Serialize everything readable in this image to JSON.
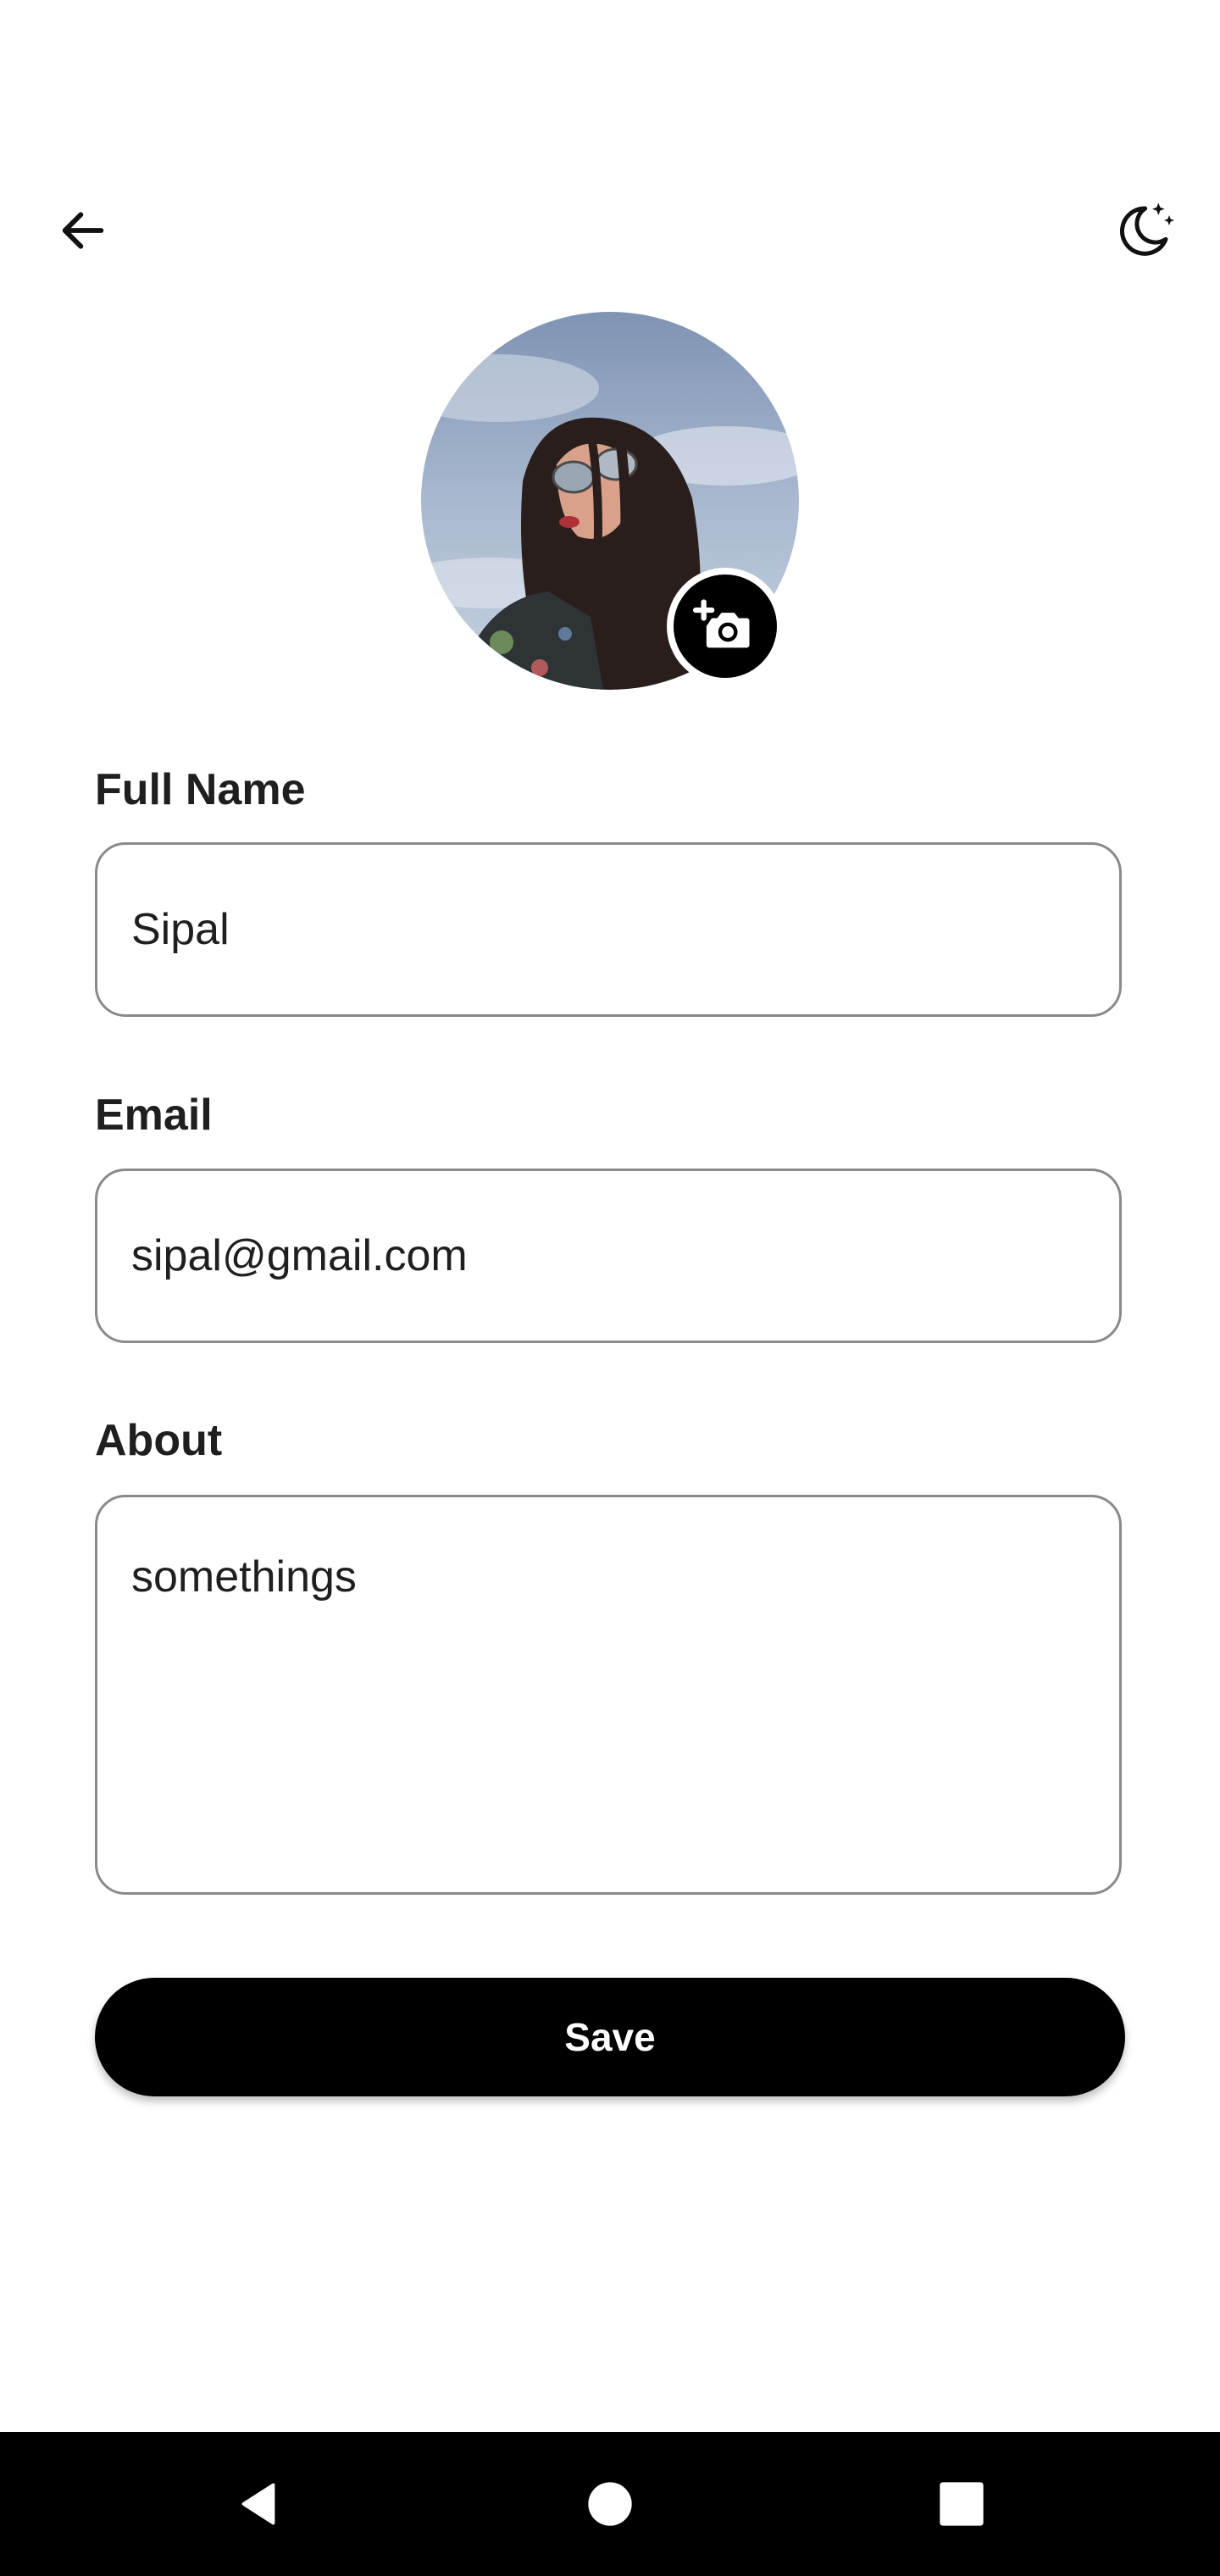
{
  "header": {
    "back_icon": "arrow-left-icon",
    "theme_icon": "moon-stars-icon"
  },
  "profile": {
    "avatar": "profile-photo",
    "camera_icon": "add-photo-camera-icon"
  },
  "form": {
    "full_name": {
      "label": "Full Name",
      "value": "Sipal"
    },
    "email": {
      "label": "Email",
      "value": "sipal@gmail.com"
    },
    "about": {
      "label": "About",
      "value": "somethings"
    },
    "save_label": "Save"
  },
  "system_nav": {
    "back_icon": "nav-back-triangle-icon",
    "home_icon": "nav-home-circle-icon",
    "recents_icon": "nav-recents-square-icon"
  },
  "colors": {
    "primary": "#000000",
    "background": "#ffffff",
    "border": "#8a8a8a",
    "text": "#1f1f1f"
  }
}
